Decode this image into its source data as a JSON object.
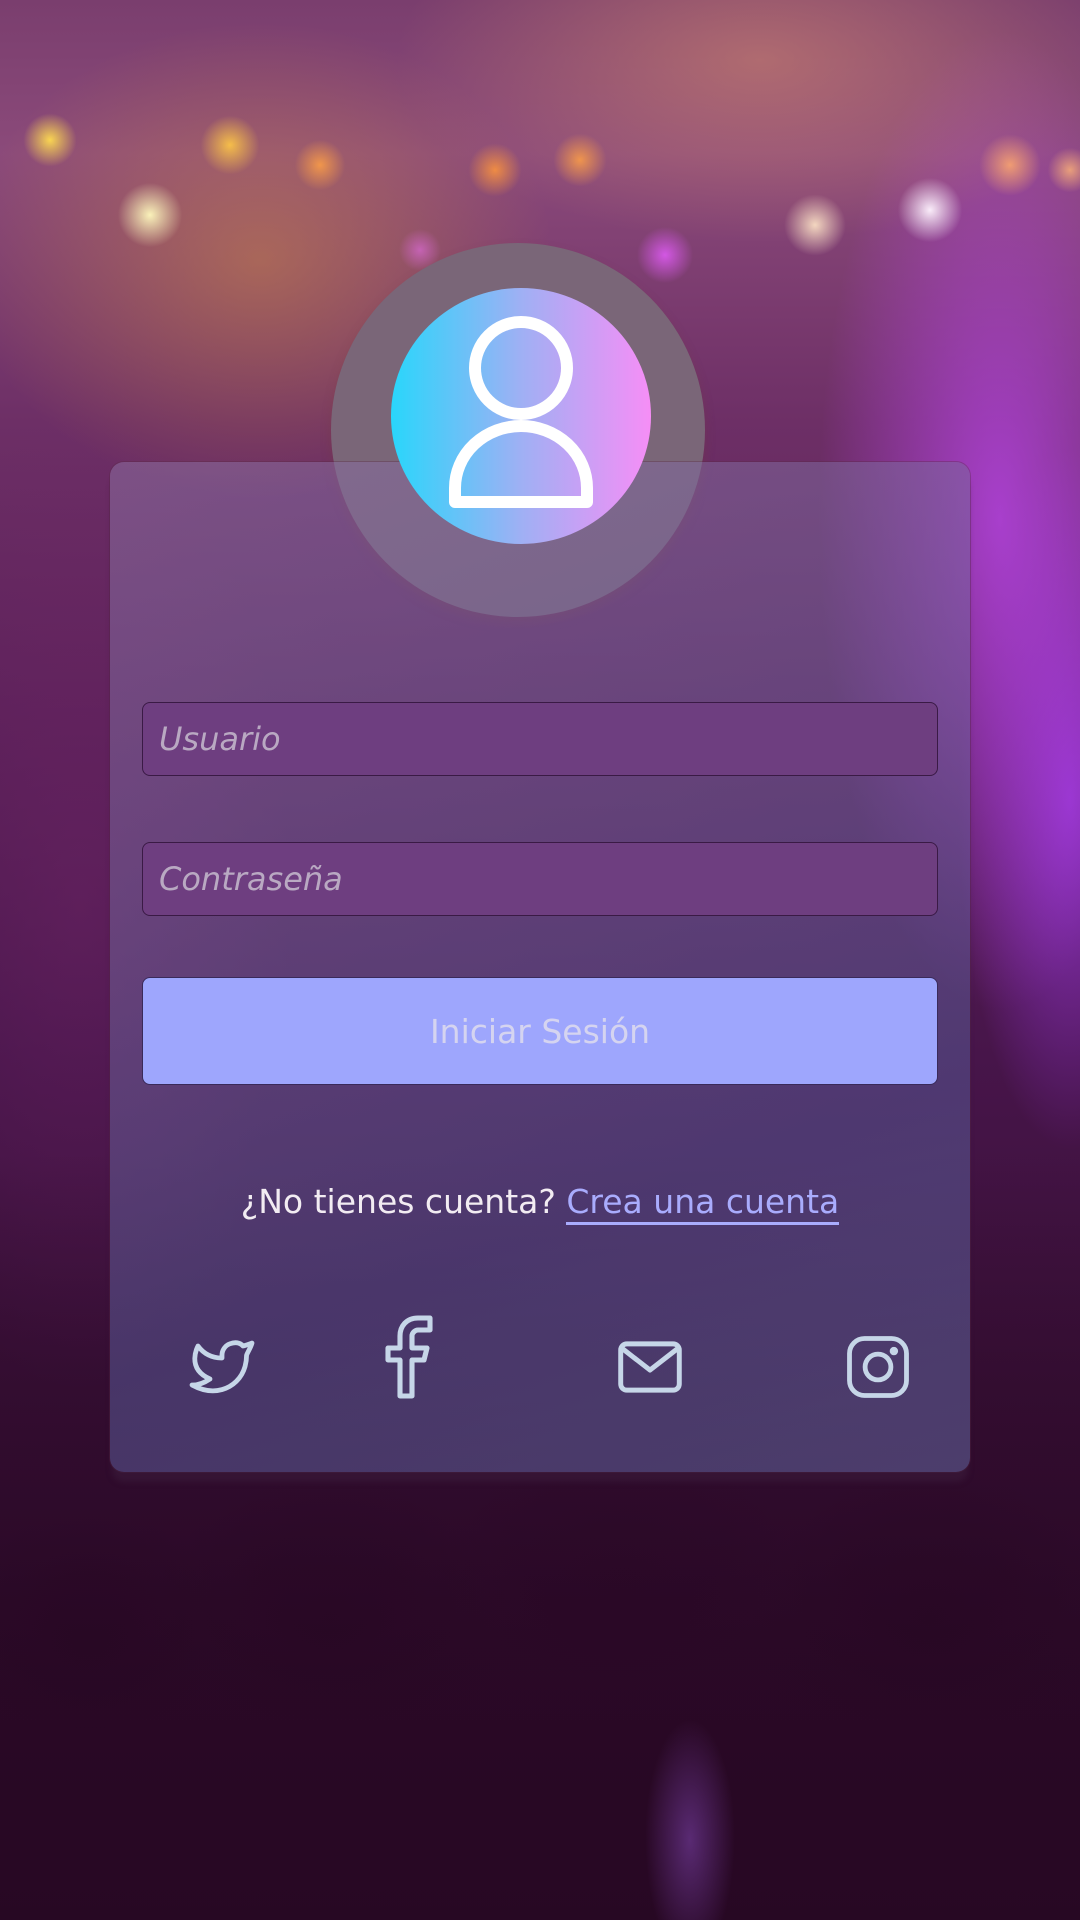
{
  "login": {
    "username_placeholder": "Usuario",
    "password_placeholder": "Contraseña",
    "submit_label": "Iniciar Sesión",
    "signup_prompt": "¿No tienes cuenta?",
    "signup_link": "Crea una cuenta"
  },
  "social": [
    {
      "icon": "twitter-icon"
    },
    {
      "icon": "facebook-icon"
    },
    {
      "icon": "mail-icon"
    },
    {
      "icon": "instagram-icon"
    }
  ],
  "colors": {
    "avatar_gradient": [
      "#29d6fb",
      "#f68ef6"
    ],
    "input_bg": "#6e3e80",
    "button_bg": "#9ea6fd",
    "link": "#a9acfd",
    "social_icon": "#c6d6e8"
  }
}
